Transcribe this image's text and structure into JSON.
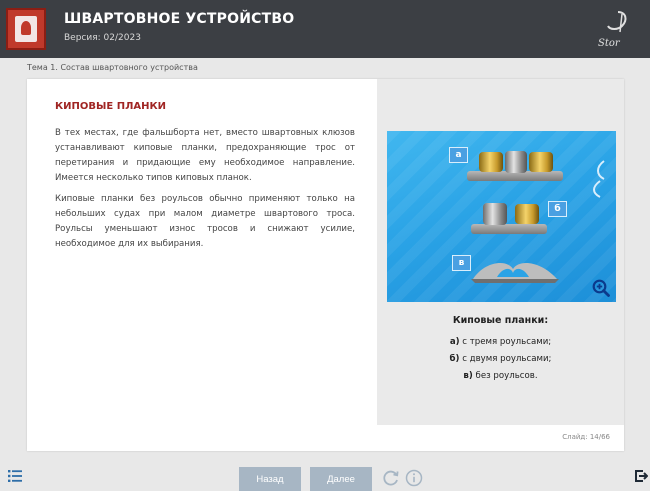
{
  "header": {
    "title": "ШВАРТОВНОЕ УСТРОЙСТВО",
    "version": "Версия: 02/2023"
  },
  "breadcrumb": "Тема 1. Состав швартовного устройства",
  "content": {
    "heading": "КИПОВЫЕ ПЛАНКИ",
    "paragraphs": [
      "В тех местах, где фальшборта нет, вместо швартовных клюзов устанавливают киповые планки, предохраняющие трос от перетирания и придающие ему необходимое направление. Имеется несколько типов киповых планок.",
      "Киповые планки без роульсов обычно применяют только на небольших судах при малом диаметре швартового троса. Роульсы уменьшают износ тросов и снижают усилие, необходимое для их выбирания."
    ]
  },
  "figure": {
    "labels": [
      "а",
      "б",
      "в"
    ],
    "caption_title": "Киповые планки:",
    "items": [
      {
        "letter": "а)",
        "text": " с тремя роульсами;"
      },
      {
        "letter": "б)",
        "text": " с двумя роульсами;"
      },
      {
        "letter": "в)",
        "text": " без роульсов."
      }
    ]
  },
  "slide_counter": "Слайд: 14/66",
  "nav": {
    "back_label": "Назад",
    "next_label": "Далее"
  },
  "colors": {
    "header_bg": "#3c3f44",
    "heading": "#a02523",
    "button": "#a7b6c4",
    "figure_bg": "#2aa3e6"
  }
}
